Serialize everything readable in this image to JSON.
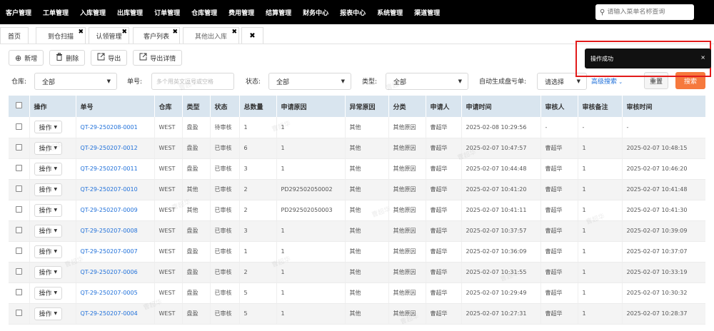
{
  "nav": {
    "items": [
      "客户管理",
      "工单管理",
      "入库管理",
      "出库管理",
      "订单管理",
      "仓库管理",
      "费用管理",
      "结算管理",
      "财务中心",
      "报表中心",
      "系统管理",
      "渠道管理"
    ],
    "search_placeholder": "请输入菜单名称查询"
  },
  "tabs": [
    {
      "label": "首页",
      "closable": false
    },
    {
      "label": "到仓扫描",
      "closable": true
    },
    {
      "label": "认领管理",
      "closable": true
    },
    {
      "label": "客户列表",
      "closable": true
    },
    {
      "label": "其他出入库",
      "closable": true,
      "active": true
    },
    {
      "label": "",
      "closable": true
    }
  ],
  "toolbar": {
    "add": "新增",
    "delete": "删除",
    "export": "导出",
    "export_detail": "导出详情"
  },
  "filter": {
    "warehouse_label": "仓库:",
    "warehouse_value": "全部",
    "code_label": "单号:",
    "code_placeholder": "多个用英文逗号或空格",
    "status_label": "状态:",
    "status_value": "全部",
    "type_label": "类型:",
    "type_value": "全部",
    "auto_label": "自动生成盘亏单:",
    "auto_value": "请选择",
    "advanced": "高级搜索",
    "reset": "重置",
    "search": "搜索"
  },
  "toast": {
    "message": "操作成功",
    "close": "×"
  },
  "watermark": "曹超华",
  "table": {
    "headers": [
      "操作",
      "单号",
      "仓库",
      "类型",
      "状态",
      "总数量",
      "申请原因",
      "异常原因",
      "分类",
      "申请人",
      "申请时间",
      "审核人",
      "审核备注",
      "审核时间"
    ],
    "op_label": "操作",
    "rows": [
      [
        "QT-29-250208-0001",
        "WEST",
        "盘盈",
        "待审核",
        "1",
        "1",
        "其他",
        "其他原因",
        "曹超华",
        "2025-02-08 10:29:56",
        "-",
        "-",
        "-"
      ],
      [
        "QT-29-250207-0012",
        "WEST",
        "盘盈",
        "已审核",
        "6",
        "1",
        "其他",
        "其他原因",
        "曹超华",
        "2025-02-07 10:47:57",
        "曹超华",
        "1",
        "2025-02-07 10:48:15"
      ],
      [
        "QT-29-250207-0011",
        "WEST",
        "盘盈",
        "已审核",
        "3",
        "1",
        "其他",
        "其他原因",
        "曹超华",
        "2025-02-07 10:44:48",
        "曹超华",
        "1",
        "2025-02-07 10:46:20"
      ],
      [
        "QT-29-250207-0010",
        "WEST",
        "其他",
        "已审核",
        "2",
        "PD292502050002",
        "其他",
        "其他原因",
        "曹超华",
        "2025-02-07 10:41:20",
        "曹超华",
        "1",
        "2025-02-07 10:41:48"
      ],
      [
        "QT-29-250207-0009",
        "WEST",
        "其他",
        "已审核",
        "2",
        "PD292502050003",
        "其他",
        "其他原因",
        "曹超华",
        "2025-02-07 10:41:11",
        "曹超华",
        "1",
        "2025-02-07 10:41:30"
      ],
      [
        "QT-29-250207-0008",
        "WEST",
        "盘盈",
        "已审核",
        "3",
        "1",
        "其他",
        "其他原因",
        "曹超华",
        "2025-02-07 10:37:57",
        "曹超华",
        "1",
        "2025-02-07 10:39:09"
      ],
      [
        "QT-29-250207-0007",
        "WEST",
        "盘盈",
        "已审核",
        "1",
        "1",
        "其他",
        "其他原因",
        "曹超华",
        "2025-02-07 10:36:09",
        "曹超华",
        "1",
        "2025-02-07 10:37:07"
      ],
      [
        "QT-29-250207-0006",
        "WEST",
        "盘盈",
        "已审核",
        "2",
        "1",
        "其他",
        "其他原因",
        "曹超华",
        "2025-02-07 10:31:55",
        "曹超华",
        "1",
        "2025-02-07 10:33:19"
      ],
      [
        "QT-29-250207-0005",
        "WEST",
        "盘盈",
        "已审核",
        "5",
        "1",
        "其他",
        "其他原因",
        "曹超华",
        "2025-02-07 10:29:49",
        "曹超华",
        "1",
        "2025-02-07 10:30:32"
      ],
      [
        "QT-29-250207-0004",
        "WEST",
        "盘盈",
        "已审核",
        "5",
        "1",
        "其他",
        "其他原因",
        "曹超华",
        "2025-02-07 10:27:31",
        "曹超华",
        "1",
        "2025-02-07 10:28:37"
      ]
    ]
  }
}
